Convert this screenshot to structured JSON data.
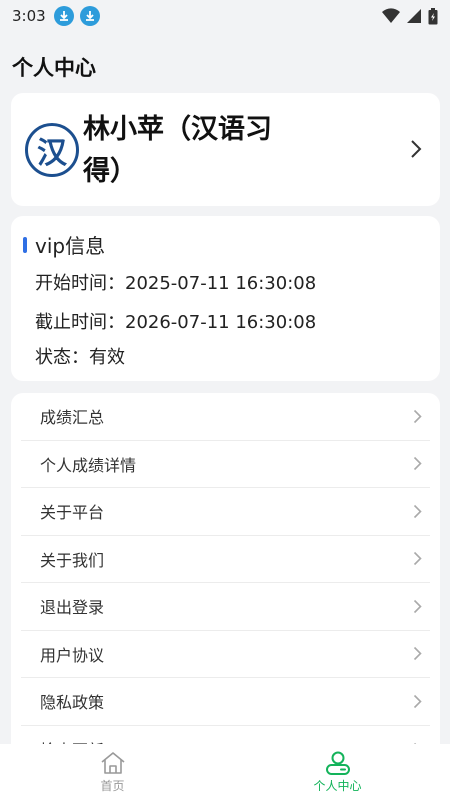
{
  "status_bar": {
    "time": "3:03"
  },
  "page_title": "个人中心",
  "profile": {
    "avatar_glyph": "汉",
    "name": "林小苹（汉语习得）"
  },
  "vip": {
    "heading": "vip信息",
    "start_label": "开始时间：",
    "start_value": "2025-07-11 16:30:08",
    "end_label": "截止时间：",
    "end_value": "2026-07-11 16:30:08",
    "status_label": "状态：",
    "status_value": "有效"
  },
  "menu": {
    "items": [
      {
        "label": "成绩汇总"
      },
      {
        "label": "个人成绩详情"
      },
      {
        "label": "关于平台"
      },
      {
        "label": "关于我们"
      },
      {
        "label": "退出登录"
      },
      {
        "label": "用户协议"
      },
      {
        "label": "隐私政策"
      },
      {
        "label": "检查更新"
      }
    ]
  },
  "tabs": [
    {
      "label": "首页",
      "icon": "home-icon",
      "active": false
    },
    {
      "label": "个人中心",
      "icon": "person-icon",
      "active": true
    }
  ],
  "colors": {
    "accent_blue": "#2f6fe4",
    "active_green": "#13b35a",
    "background": "#f2f3f5"
  }
}
